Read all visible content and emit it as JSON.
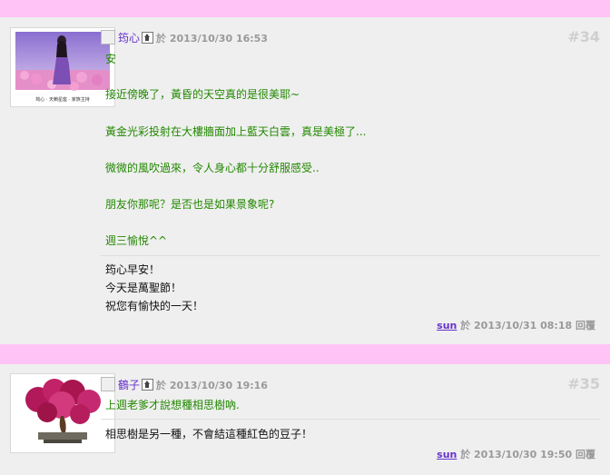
{
  "posts": [
    {
      "author": "筠心",
      "time_label": "於 2013/10/30 16:53",
      "floor": "#34",
      "avatar_caption": "筠心 · 天賴星座 · 家族主持",
      "lines": [
        "安",
        "接近傍晚了，黃昏的天空真的是很美耶~",
        "黃金光彩投射在大樓牆面加上藍天白雲，真是美極了...",
        "微微的風吹過來，令人身心都十分舒服感受..",
        "朋友你那呢？是否也是如果景象呢?",
        "週三愉悅^^"
      ],
      "reply_lines": [
        "筠心早安！",
        "今天是萬聖節！",
        "祝您有愉快的一天！"
      ],
      "reply_author": "sun",
      "reply_time": "於 2013/10/31 08:18",
      "reply_action": "回覆"
    },
    {
      "author": "鶴子",
      "time_label": "於 2013/10/30 19:16",
      "floor": "#35",
      "lines": [
        "上週老爹才說想種相思樹吶."
      ],
      "reply_lines": [
        "相思樹是另一種，不會結這種紅色的豆子！"
      ],
      "reply_author": "sun",
      "reply_time": "於 2013/10/30 19:50",
      "reply_action": "回覆"
    }
  ],
  "colors": {
    "band": "#ffc4f5",
    "message_text": "#228800",
    "author_link": "#6633cc"
  }
}
